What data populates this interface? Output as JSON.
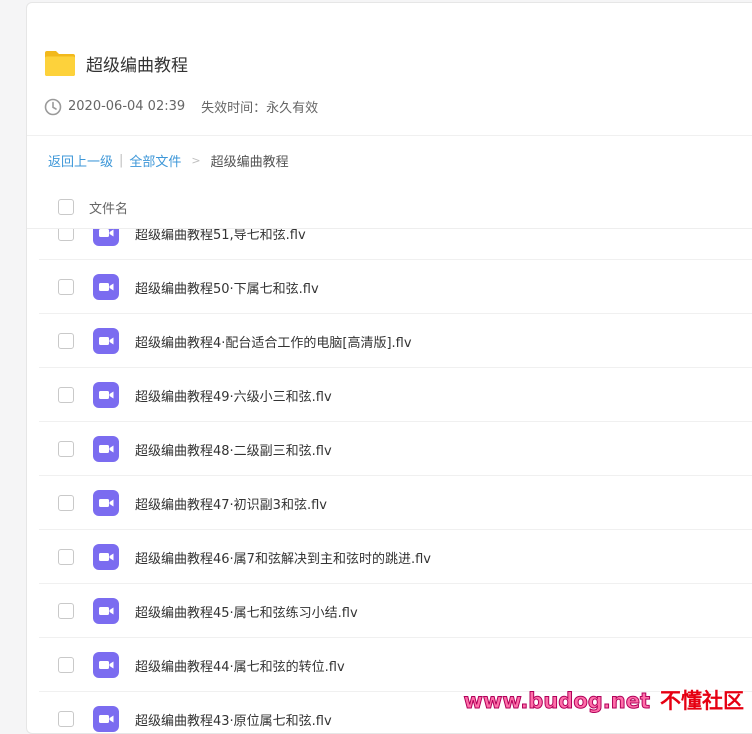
{
  "folder": {
    "title": "超级编曲教程",
    "icon": "folder-icon",
    "icon_color": "#f7c52a"
  },
  "meta": {
    "created": "2020-06-04 02:39",
    "expire": "失效时间：永久有效"
  },
  "breadcrumb": {
    "back": "返回上一级",
    "separator": "|",
    "all_files": "全部文件",
    "arrow": ">",
    "current": "超级编曲教程"
  },
  "list": {
    "column_name": "文件名",
    "files": [
      "超级编曲教程51,导七和弦.flv",
      "超级编曲教程50·下属七和弦.flv",
      "超级编曲教程4·配台适合工作的电脑[高清版].flv",
      "超级编曲教程49·六级小三和弦.flv",
      "超级编曲教程48·二级副三和弦.flv",
      "超级编曲教程47·初识副3和弦.flv",
      "超级编曲教程46·属7和弦解决到主和弦时的跳进.flv",
      "超级编曲教程45·属七和弦练习小结.flv",
      "超级编曲教程44·属七和弦的转位.flv",
      "超级编曲教程43·原位属七和弦.flv"
    ]
  },
  "colors": {
    "link": "#3d97d8",
    "video_icon": "#7b6cf0"
  },
  "watermark": {
    "url": "www.budog.net",
    "name": "不懂社区"
  }
}
